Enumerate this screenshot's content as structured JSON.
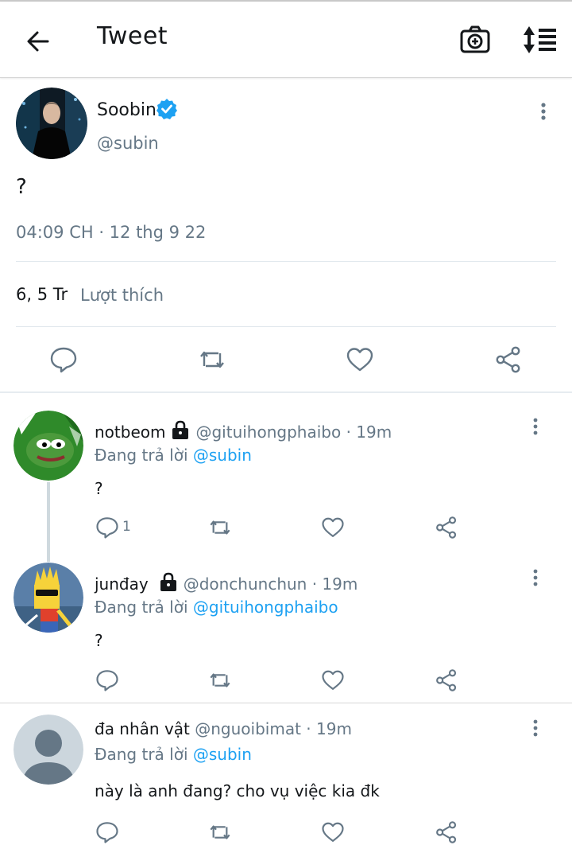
{
  "header": {
    "title": "Tweet",
    "back_icon": "arrow-left-icon",
    "camera_icon": "camera-plus-icon",
    "sort_icon": "sort-list-icon"
  },
  "tweet": {
    "display_name": "Soobin",
    "handle": "@subin",
    "text": "?",
    "timestamp": "04:09 CH · 12 thg 9 22",
    "likes_count": "6, 5 Tr",
    "likes_label": "Lượt thích"
  },
  "replies": [
    {
      "display_name": "notbeom",
      "locked": true,
      "handle": "@gituihongphaibo",
      "time": "· 19m",
      "replying_prefix": "Đang trả lời",
      "replying_to": "@subin",
      "text": "?",
      "reply_count": "1"
    },
    {
      "display_name": "junđay",
      "locked": true,
      "handle": "@donchunchun",
      "time": "· 19m",
      "replying_prefix": "Đang trả lời",
      "replying_to": "@gituihongphaibo",
      "text": "?",
      "reply_count": ""
    },
    {
      "display_name": "đa nhân vật",
      "locked": false,
      "handle": "@nguoibimat",
      "time": "· 19m",
      "replying_prefix": "Đang trả lời",
      "replying_to": "@subin",
      "text": "này là anh đang?  cho vụ việc kia đk",
      "reply_count": ""
    }
  ],
  "colors": {
    "accent": "#1da1f2",
    "secondary_text": "#657786",
    "icon": "#657786"
  }
}
